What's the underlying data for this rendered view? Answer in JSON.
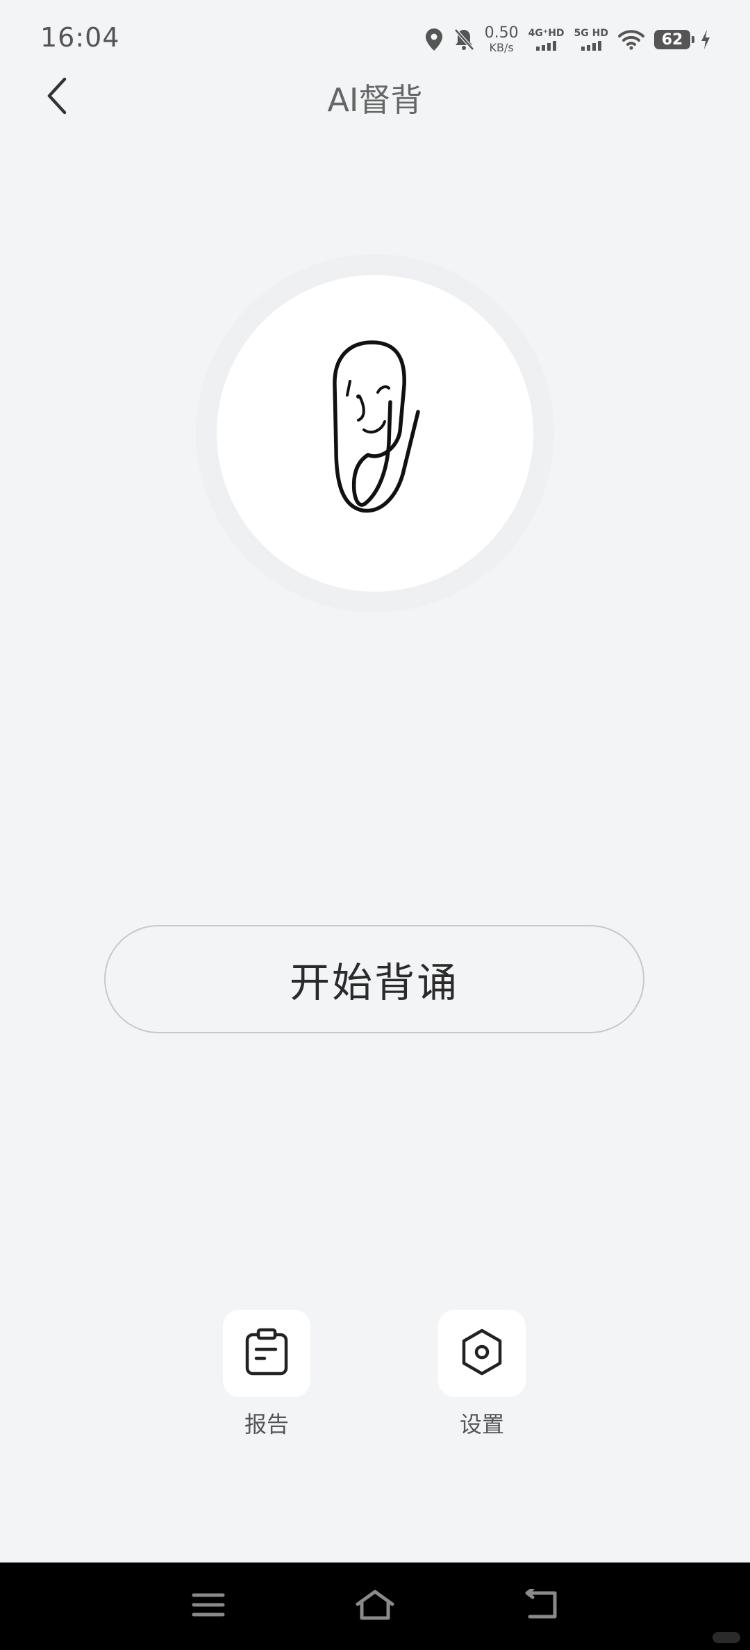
{
  "status_bar": {
    "time": "16:04",
    "net_speed_value": "0.50",
    "net_speed_unit": "KB/s",
    "sim1_label": "4G⁺HD",
    "sim2_label": "5G HD",
    "battery": "62",
    "icons": [
      "location-icon",
      "bell-muted-icon",
      "wifi-icon",
      "charging-icon"
    ]
  },
  "header": {
    "title": "AI督背",
    "back_icon": "chevron-left-icon"
  },
  "main": {
    "avatar_icon": "paperclip-mascot-icon",
    "start_button_label": "开始背诵"
  },
  "actions": [
    {
      "label": "报告",
      "icon": "clipboard-icon"
    },
    {
      "label": "设置",
      "icon": "hexagon-gear-icon"
    }
  ],
  "nav_bar": {
    "icons": [
      "menu-icon",
      "home-icon",
      "back-icon"
    ]
  },
  "colors": {
    "background": "#f3f4f6",
    "tile": "#ffffff",
    "text_primary": "#2a2a2a",
    "text_secondary": "#555555",
    "nav_background": "#000000"
  }
}
